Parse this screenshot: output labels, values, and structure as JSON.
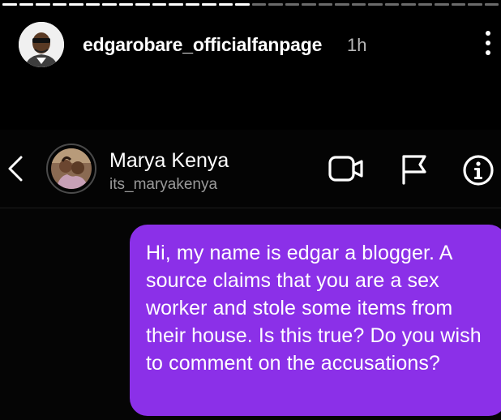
{
  "story": {
    "progress": {
      "segments_total": 30,
      "segments_viewed": 15
    },
    "author": {
      "handle": "edgarobare_officialfanpage",
      "time_ago": "1h",
      "avatar_icon": "profile-photo"
    },
    "more_icon": "more-vertical-icon"
  },
  "dm": {
    "back_icon": "chevron-left-icon",
    "contact": {
      "name": "Marya Kenya",
      "username": "its_maryakenya",
      "avatar_icon": "profile-photo"
    },
    "actions": [
      "video-call-icon",
      "flag-icon",
      "info-icon"
    ],
    "message": {
      "text": "Hi, my name is edgar a blogger. A source claims that you are a sex worker and stole some items from their house. Is this true? Do you wish to comment on the accusations?",
      "bubble_color": "#8b30e8"
    }
  },
  "colors": {
    "background": "#000000",
    "header_bg": "#040404",
    "secondary_text": "#9a9a9a",
    "bubble": "#8b30e8"
  }
}
